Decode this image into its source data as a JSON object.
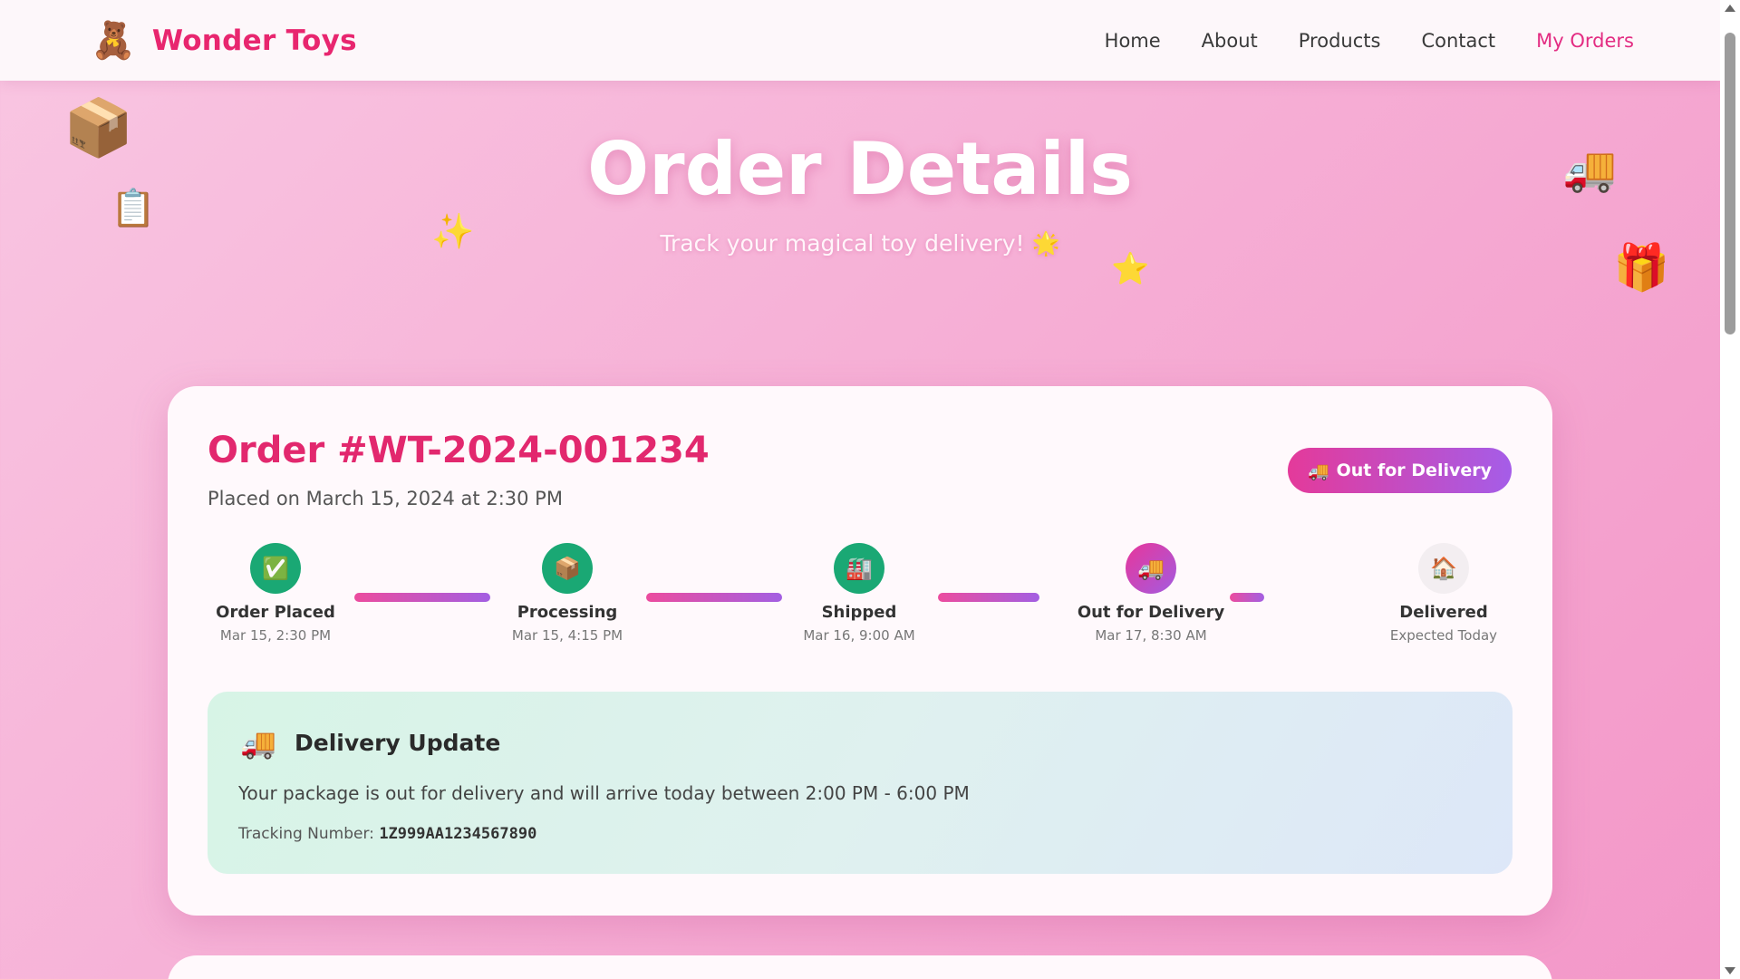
{
  "nav": {
    "brand_icon": "🧸",
    "brand_name": "Wonder Toys",
    "links": [
      {
        "label": "Home"
      },
      {
        "label": "About"
      },
      {
        "label": "Products"
      },
      {
        "label": "Contact"
      },
      {
        "label": "My Orders",
        "active": true
      }
    ]
  },
  "hero": {
    "title": "Order Details",
    "subtitle": "Track your magical toy delivery! 🌟",
    "decorations": [
      "📦",
      "📋",
      "✨",
      "⭐",
      "🚚",
      "🎁"
    ]
  },
  "order": {
    "title": "Order #WT-2024-001234",
    "placed": "Placed on March 15, 2024 at 2:30 PM",
    "status_icon": "🚚",
    "status_label": "Out for Delivery",
    "steps": [
      {
        "icon": "✅",
        "name": "Order Placed",
        "date": "Mar 15, 2:30 PM",
        "state": "done"
      },
      {
        "icon": "📦",
        "name": "Processing",
        "date": "Mar 15, 4:15 PM",
        "state": "done"
      },
      {
        "icon": "🏭",
        "name": "Shipped",
        "date": "Mar 16, 9:00 AM",
        "state": "done"
      },
      {
        "icon": "🚚",
        "name": "Out for Delivery",
        "date": "Mar 17, 8:30 AM",
        "state": "current"
      },
      {
        "icon": "🏠",
        "name": "Delivered",
        "date": "Expected Today",
        "state": "pending"
      }
    ],
    "update": {
      "icon": "🚚",
      "title": "Delivery Update",
      "text": "Your package is out for delivery and will arrive today between 2:00 PM - 6:00 PM",
      "tracking_label": "Tracking Number:",
      "tracking_number": "1Z999AA1234567890"
    }
  },
  "colors": {
    "brand": "#e8266f",
    "active_nav": "#e32c82",
    "done_step": "#1aa874",
    "gradient_start": "#e43a9a",
    "gradient_end": "#a55de8"
  }
}
